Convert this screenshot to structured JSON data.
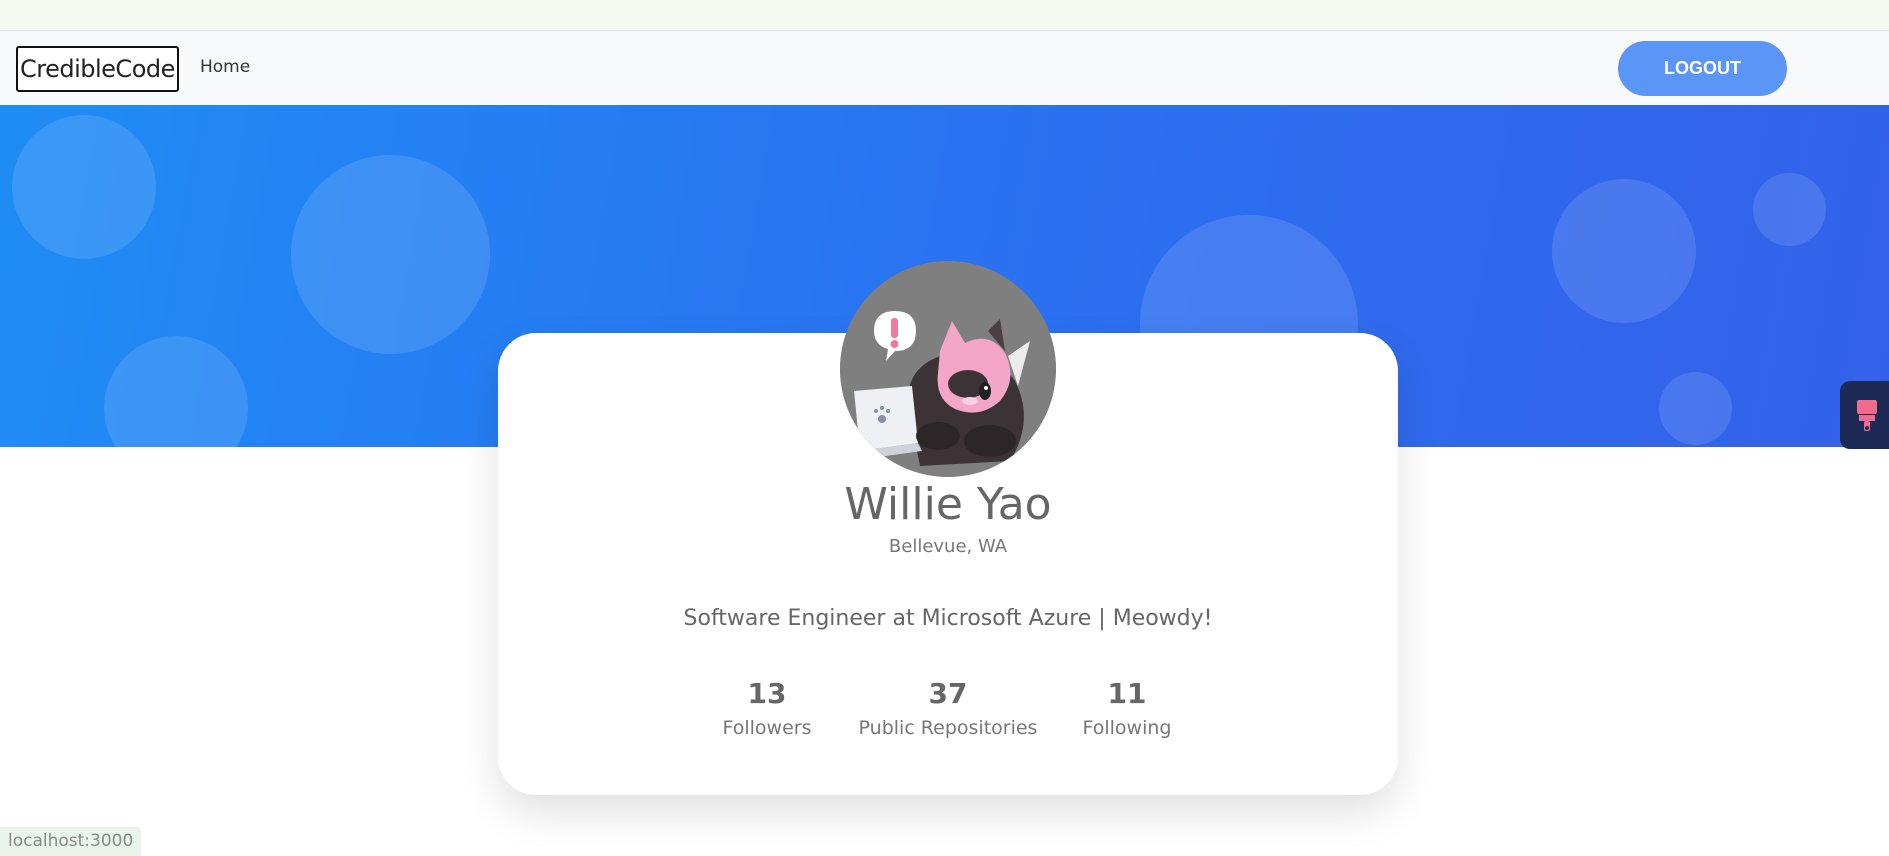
{
  "nav": {
    "brand": "CredibleCode",
    "home": "Home",
    "logout": "LOGOUT"
  },
  "profile": {
    "name": "Willie Yao",
    "location": "Bellevue, WA",
    "bio": "Software Engineer at Microsoft Azure | Meowdy!",
    "stats": [
      {
        "value": "13",
        "label": "Followers"
      },
      {
        "value": "37",
        "label": "Public Repositories"
      },
      {
        "value": "11",
        "label": "Following"
      }
    ]
  },
  "status_bar": {
    "url": "localhost:3000"
  },
  "colors": {
    "accent": "#5b95f5",
    "hero_start": "#1f8cf5",
    "hero_end": "#3461ea"
  }
}
